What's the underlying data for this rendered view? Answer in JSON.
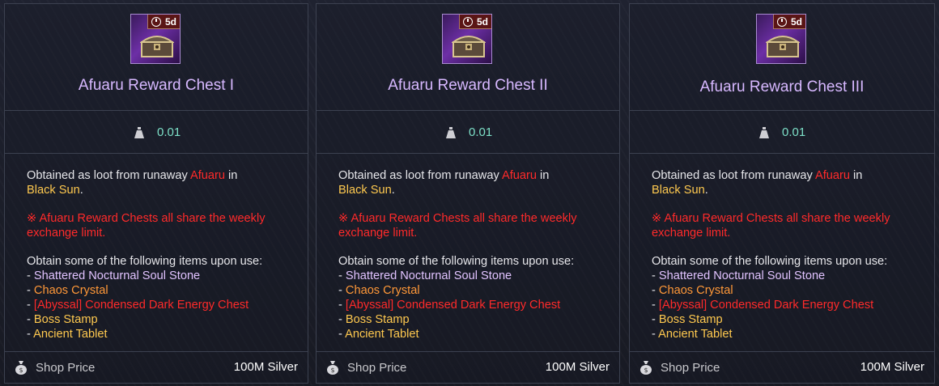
{
  "cards": [
    {
      "title": "Afuaru Reward Chest I",
      "badge": "5d",
      "weight": "0.01",
      "obtained_prefix": "Obtained as loot from runaway ",
      "obtained_name": "Afuaru",
      "obtained_mid": " in",
      "obtained_place": "Black Sun",
      "obtained_end": ".",
      "notice": "※ Afuaru Reward Chests all share the weekly exchange limit.",
      "items_intro": "Obtain some of the following items upon use:",
      "items": [
        {
          "dash": "- ",
          "name": "Shattered Nocturnal Soul Stone"
        },
        {
          "dash": "- ",
          "name": "Chaos Crystal"
        },
        {
          "dash": "- ",
          "name": "[Abyssal] Condensed Dark Energy Chest"
        },
        {
          "dash": "- ",
          "name": "Boss Stamp"
        },
        {
          "dash": "- ",
          "name": "Ancient Tablet"
        }
      ],
      "shop_label": "Shop Price",
      "price": "100M Silver"
    },
    {
      "title": "Afuaru Reward Chest II",
      "badge": "5d",
      "weight": "0.01",
      "obtained_prefix": "Obtained as loot from runaway ",
      "obtained_name": "Afuaru",
      "obtained_mid": " in",
      "obtained_place": "Black Sun",
      "obtained_end": ".",
      "notice": "※ Afuaru Reward Chests all share the weekly exchange limit.",
      "items_intro": "Obtain some of the following items upon use:",
      "items": [
        {
          "dash": "- ",
          "name": "Shattered Nocturnal Soul Stone"
        },
        {
          "dash": "- ",
          "name": "Chaos Crystal"
        },
        {
          "dash": "- ",
          "name": "[Abyssal] Condensed Dark Energy Chest"
        },
        {
          "dash": "- ",
          "name": "Boss Stamp"
        },
        {
          "dash": "- ",
          "name": "Ancient Tablet"
        }
      ],
      "shop_label": "Shop Price",
      "price": "100M Silver"
    },
    {
      "title": "Afuaru Reward Chest III",
      "badge": "5d",
      "weight": "0.01",
      "obtained_prefix": "Obtained as loot from runaway ",
      "obtained_name": "Afuaru",
      "obtained_mid": " in",
      "obtained_place": "Black Sun",
      "obtained_end": ".",
      "notice": "※ Afuaru Reward Chests all share the weekly exchange limit.",
      "items_intro": "Obtain some of the following items upon use:",
      "items": [
        {
          "dash": "- ",
          "name": "Shattered Nocturnal Soul Stone"
        },
        {
          "dash": "- ",
          "name": "Chaos Crystal"
        },
        {
          "dash": "- ",
          "name": "[Abyssal] Condensed Dark Energy Chest"
        },
        {
          "dash": "- ",
          "name": "Boss Stamp"
        },
        {
          "dash": "- ",
          "name": "Ancient Tablet"
        }
      ],
      "shop_label": "Shop Price",
      "price": "100M Silver"
    }
  ],
  "colors": {
    "title": "#d7b8ff",
    "weight": "#7de0c8",
    "red": "#ff2a2a",
    "gold": "#ffc94f",
    "orange": "#ff9838",
    "purple": "#e1c3ff"
  },
  "icons": {
    "item": "treasure-chest-icon",
    "badge": "clock-icon",
    "weight": "weight-icon",
    "shop": "money-bag-icon"
  }
}
